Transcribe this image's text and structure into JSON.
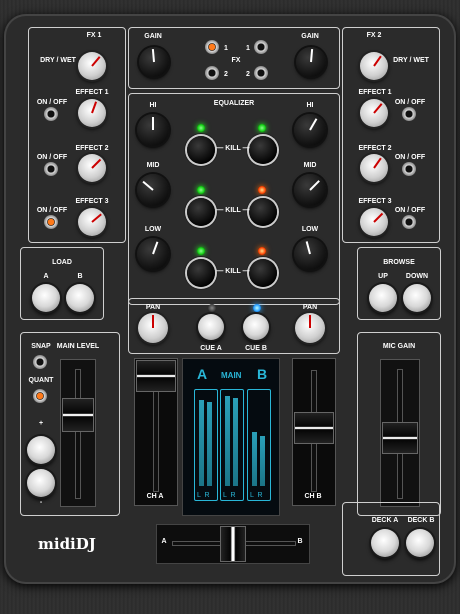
{
  "app_title": "midiDJ",
  "left": {
    "fx": "FX 1",
    "dry_wet": "DRY / WET",
    "on_off": "ON / OFF",
    "effect1": "EFFECT 1",
    "effect2": "EFFECT 2",
    "effect3": "EFFECT 3",
    "load": "LOAD",
    "a": "A",
    "b": "B",
    "snap": "SNAP",
    "quant": "QUANT",
    "main_level": "MAIN LEVEL",
    "plus": "+",
    "minus": "-"
  },
  "right": {
    "fx": "FX 2",
    "dry_wet": "DRY / WET",
    "on_off": "ON / OFF",
    "effect1": "EFFECT 1",
    "effect2": "EFFECT 2",
    "effect3": "EFFECT 3",
    "browse": "BROWSE",
    "up": "UP",
    "down": "DOWN",
    "mic_gain": "MIC GAIN",
    "deck_a": "DECK A",
    "deck_b": "DECK B"
  },
  "center": {
    "gain": "GAIN",
    "fx": "FX",
    "fx1": "1",
    "fx2": "2",
    "equalizer": "EQUALIZER",
    "hi": "HI",
    "mid": "MID",
    "low": "LOW",
    "kill": "— KILL —",
    "pan": "PAN",
    "cue_a": "CUE A",
    "cue_b": "CUE B",
    "ch_a": "CH A",
    "ch_b": "CH B",
    "main": "MAIN",
    "meter_a": "A",
    "meter_b": "B",
    "lr": "L  R",
    "xfade_a": "A",
    "xfade_b": "B"
  },
  "colors": {
    "accent": "#29b7d8",
    "led_green": "#22dd22",
    "led_red": "#ff5a10",
    "led_blue": "#22a0ff"
  }
}
